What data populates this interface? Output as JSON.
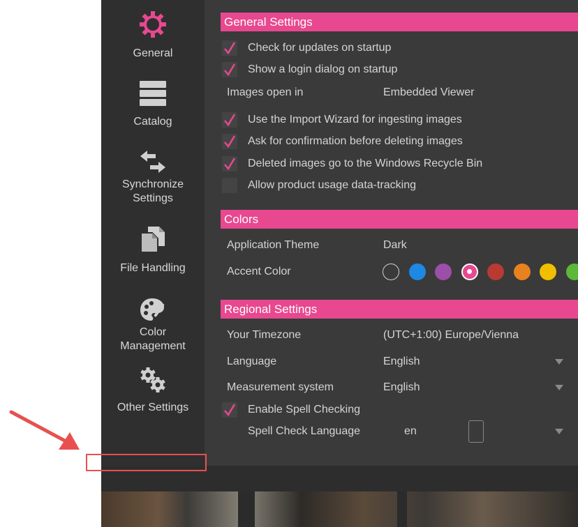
{
  "sidebar": {
    "items": [
      {
        "label": "General",
        "icon": "gear-icon"
      },
      {
        "label": "Catalog",
        "icon": "catalog-icon"
      },
      {
        "label": "Synchronize\nSettings",
        "icon": "sync-arrows-icon"
      },
      {
        "label": "File Handling",
        "icon": "files-icon"
      },
      {
        "label": "Color\nManagement",
        "icon": "palette-icon"
      },
      {
        "label": "Other Settings",
        "icon": "gears-icon"
      }
    ]
  },
  "general": {
    "header": "General Settings",
    "check_updates": {
      "label": "Check for updates on startup",
      "checked": true
    },
    "login_dialog": {
      "label": "Show a login dialog on startup",
      "checked": true
    },
    "images_open_in": {
      "label": "Images open in",
      "value": "Embedded Viewer"
    },
    "import_wizard": {
      "label": "Use the Import Wizard for ingesting images",
      "checked": true
    },
    "ask_confirm": {
      "label": "Ask for confirmation before deleting images",
      "checked": true
    },
    "recycle_bin": {
      "label": "Deleted images go to the Windows Recycle Bin",
      "checked": true
    },
    "usage_tracking": {
      "label": "Allow product usage data-tracking",
      "checked": false
    }
  },
  "colors": {
    "header": "Colors",
    "theme": {
      "label": "Application Theme",
      "value": "Dark"
    },
    "accent": {
      "label": "Accent Color",
      "swatches": [
        "#3a3a3a",
        "#1e88e5",
        "#9b4fa8",
        "#e8488f",
        "#b83a32",
        "#e8821e",
        "#f0c000",
        "#5cb83a"
      ],
      "selected_index": 3
    }
  },
  "regional": {
    "header": "Regional Settings",
    "timezone": {
      "label": "Your Timezone",
      "value": "(UTC+1:00) Europe/Vienna"
    },
    "language": {
      "label": "Language",
      "value": "English"
    },
    "measurement": {
      "label": "Measurement system",
      "value": "English"
    },
    "spell_check": {
      "label": "Enable Spell Checking",
      "checked": true
    },
    "spell_lang": {
      "label": "Spell Check Language",
      "value": "en"
    }
  },
  "colors_meta": {
    "accent": "#e8488f",
    "annotation": "#e85050"
  }
}
